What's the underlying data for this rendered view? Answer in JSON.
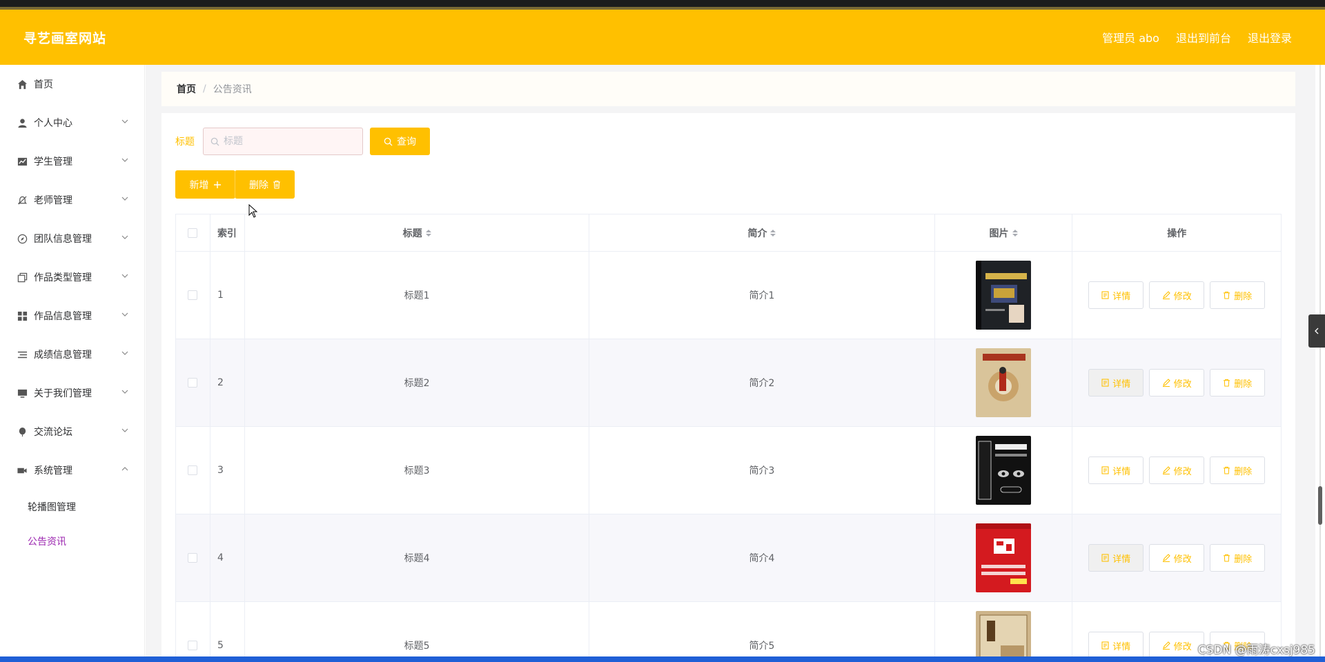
{
  "header": {
    "brand": "寻艺画室网站",
    "links": [
      "管理员 abo",
      "退出到前台",
      "退出登录"
    ],
    "accent_color": "#ffc000"
  },
  "sidebar": {
    "items": [
      {
        "label": "首页",
        "icon": "home-icon",
        "expandable": false
      },
      {
        "label": "个人中心",
        "icon": "user-icon",
        "expandable": true
      },
      {
        "label": "学生管理",
        "icon": "chart-icon",
        "expandable": true
      },
      {
        "label": "老师管理",
        "icon": "bell-off-icon",
        "expandable": true
      },
      {
        "label": "团队信息管理",
        "icon": "compass-icon",
        "expandable": true
      },
      {
        "label": "作品类型管理",
        "icon": "copy-icon",
        "expandable": true
      },
      {
        "label": "作品信息管理",
        "icon": "grid-icon",
        "expandable": true
      },
      {
        "label": "成绩信息管理",
        "icon": "list-icon",
        "expandable": true
      },
      {
        "label": "关于我们管理",
        "icon": "monitor-icon",
        "expandable": true
      },
      {
        "label": "交流论坛",
        "icon": "balloon-icon",
        "expandable": true
      },
      {
        "label": "系统管理",
        "icon": "camera-icon",
        "expandable": true,
        "expanded": true
      }
    ],
    "subitems": [
      {
        "label": "轮播图管理",
        "active": false
      },
      {
        "label": "公告资讯",
        "active": true
      }
    ]
  },
  "breadcrumb": {
    "home": "首页",
    "separator": "/",
    "current": "公告资讯"
  },
  "search": {
    "label": "标题",
    "placeholder": "标题",
    "value": "",
    "query_button": "查询"
  },
  "actions": {
    "add": "新增",
    "delete": "删除"
  },
  "table": {
    "headers": {
      "index": "索引",
      "title": "标题",
      "brief": "简介",
      "image": "图片",
      "operations": "操作"
    },
    "rows": [
      {
        "index": "1",
        "title": "标题1",
        "brief": "简介1",
        "image": "book-cover-java"
      },
      {
        "index": "2",
        "title": "标题2",
        "brief": "简介2",
        "image": "book-cover-orange"
      },
      {
        "index": "3",
        "title": "标题3",
        "brief": "简介3",
        "image": "book-cover-psychology"
      },
      {
        "index": "4",
        "title": "标题4",
        "brief": "简介4",
        "image": "book-cover-red"
      },
      {
        "index": "5",
        "title": "标题5",
        "brief": "简介5",
        "image": "book-cover-classic"
      }
    ],
    "row_buttons": {
      "detail": "详情",
      "edit": "修改",
      "delete": "删除"
    }
  },
  "watermark": "CSDN @雨涛cxsj985"
}
